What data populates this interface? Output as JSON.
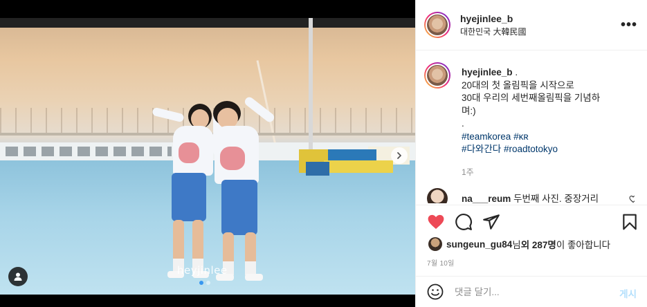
{
  "post": {
    "username": "hyejinlee_b",
    "location": "대한민국 大韓民國",
    "more_label": "•••",
    "watermark": "heyjinlee",
    "caption": {
      "username": "hyejinlee_b",
      "text_lines": [
        "20대의 첫 올림픽을 시작으로",
        "30대 우리의 세번째올림픽을 기념하",
        "며:)",
        "."
      ],
      "hashtags_line1": [
        "#teamkorea",
        "#ĸʀ"
      ],
      "hashtags_line2": [
        "#다와간다",
        "#roadtotokyo"
      ],
      "time_ago": "1주"
    },
    "comment": {
      "username": "na___reum",
      "text": "두번째 사진. 중장거리"
    },
    "likes": {
      "liker": "sungeun_gu84",
      "mid": "님 ",
      "count_label": "외 287명",
      "suffix": "이 좋아합니다"
    },
    "date": "7월 10일",
    "add_comment": {
      "placeholder": "댓글 달기...",
      "post_label": "게시"
    },
    "carousel": {
      "slide_count": 2,
      "active_slide": 1
    },
    "liked": true,
    "icons": {
      "like": "heart-filled-icon",
      "comment": "comment-icon",
      "share": "paper-plane-icon",
      "save": "bookmark-icon",
      "emoji": "emoji-icon",
      "next": "chevron-right-icon",
      "tagged_users": "user-icon"
    },
    "colors": {
      "like": "#ed4956",
      "link": "#00376b",
      "post_button": "#b2dffc",
      "carousel_active": "#3897f0"
    }
  }
}
